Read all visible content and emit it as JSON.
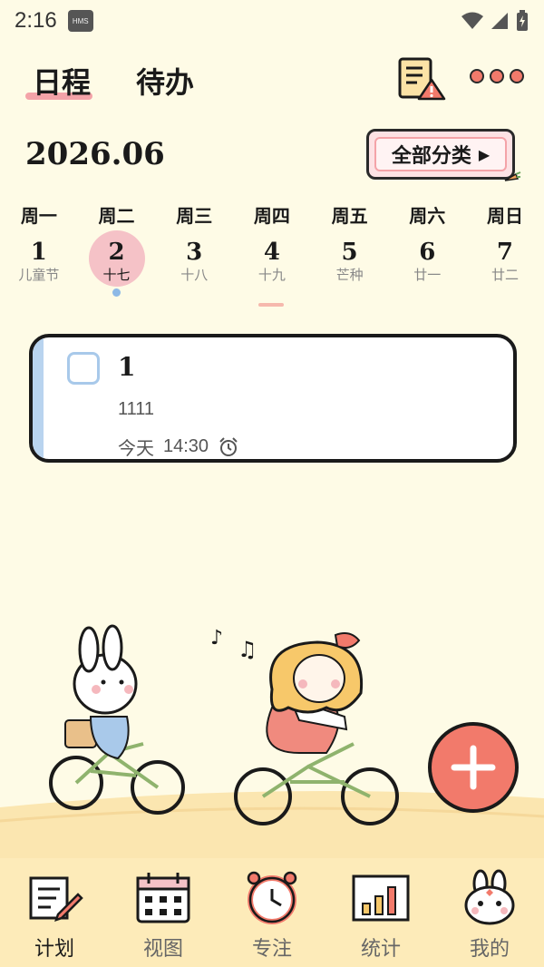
{
  "status_bar": {
    "time": "2:16",
    "badge": "HMS"
  },
  "header": {
    "tabs": [
      {
        "label": "日程",
        "active": true
      },
      {
        "label": "待办",
        "active": false
      }
    ],
    "icons": [
      "report-warning-icon",
      "more-icon"
    ]
  },
  "calendar": {
    "month": "2026.06",
    "category_button": "全部分类",
    "weekdays": [
      "周一",
      "周二",
      "周三",
      "周四",
      "周五",
      "周六",
      "周日"
    ],
    "dates": [
      {
        "day": "1",
        "sub": "儿童节"
      },
      {
        "day": "2",
        "sub": "十七",
        "selected": true
      },
      {
        "day": "3",
        "sub": "十八"
      },
      {
        "day": "4",
        "sub": "十九",
        "today": true
      },
      {
        "day": "5",
        "sub": "芒种"
      },
      {
        "day": "6",
        "sub": "廿一"
      },
      {
        "day": "7",
        "sub": "廿二"
      }
    ]
  },
  "task": {
    "title": "1",
    "note": "1111",
    "date": "今天",
    "time": "14:30"
  },
  "bottom_nav": [
    {
      "label": "计划",
      "icon": "plan-icon",
      "active": true
    },
    {
      "label": "视图",
      "icon": "calendar-view-icon",
      "active": false
    },
    {
      "label": "专注",
      "icon": "alarm-clock-icon",
      "active": false
    },
    {
      "label": "统计",
      "icon": "chart-icon",
      "active": false
    },
    {
      "label": "我的",
      "icon": "bunny-icon",
      "active": false
    }
  ],
  "colors": {
    "background": "#fefbe6",
    "accent_pink": "#f5c2c7",
    "fab": "#f27a6b",
    "nav_bg": "#fdebb9",
    "task_accent": "#b9d4ef"
  }
}
